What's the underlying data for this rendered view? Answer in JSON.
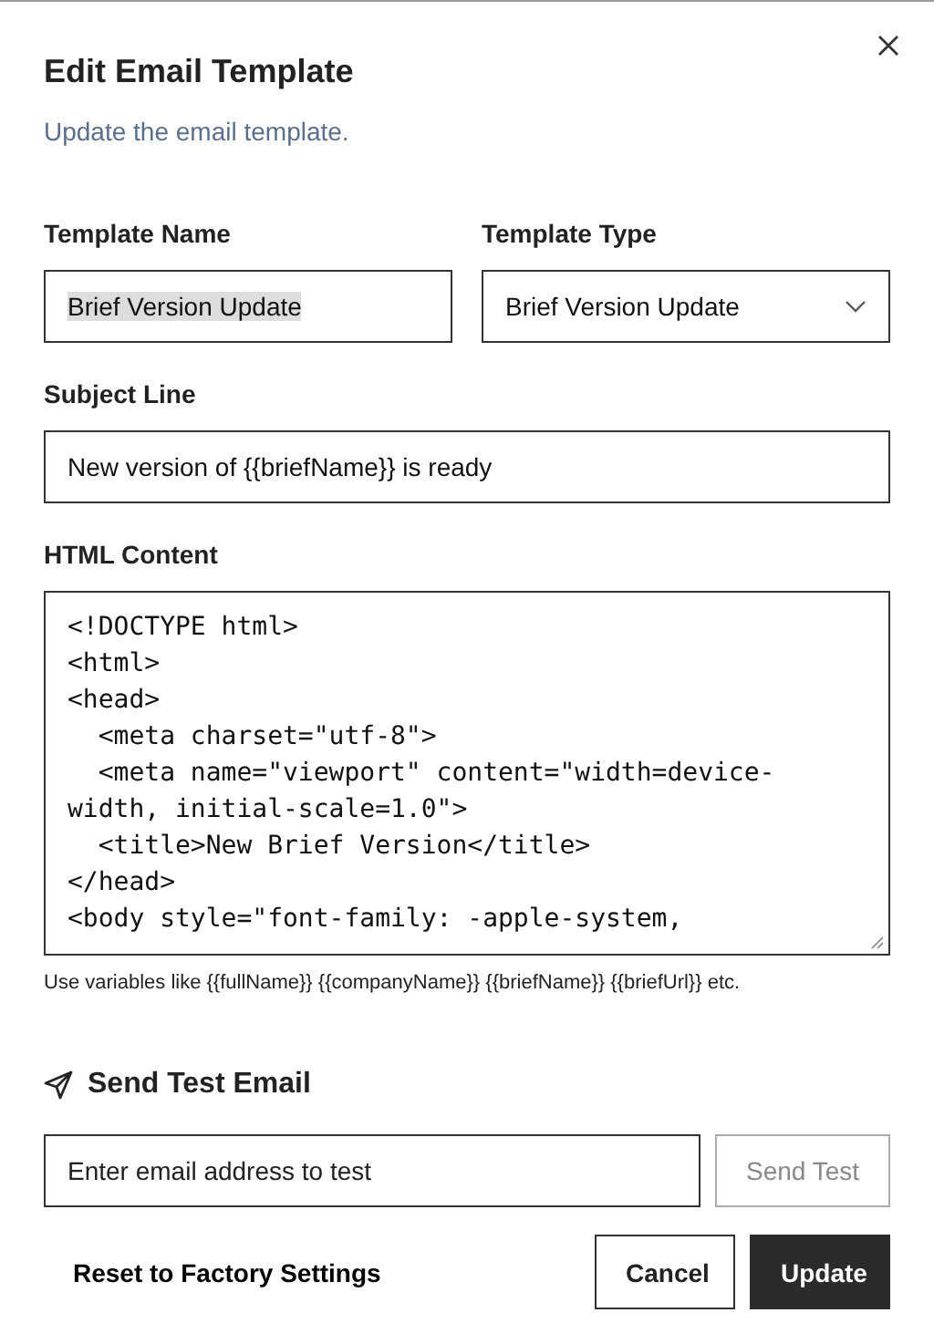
{
  "dialog": {
    "title": "Edit Email Template",
    "description": "Update the email template."
  },
  "fields": [
    {
      "kind": "text",
      "label": "Template Name",
      "value": "Brief Version Update",
      "text_selected": true
    },
    {
      "kind": "select",
      "label": "Template Type",
      "value": "Brief Version Update"
    }
  ],
  "subject": {
    "label": "Subject Line",
    "value": "New version of {{briefName}} is ready"
  },
  "html_content": {
    "label": "HTML Content",
    "value": "<!DOCTYPE html>\n<html>\n<head>\n  <meta charset=\"utf-8\">\n  <meta name=\"viewport\" content=\"width=device-width, initial-scale=1.0\">\n  <title>New Brief Version</title>\n</head>\n<body style=\"font-family: -apple-system,",
    "hint": "Use variables like {{fullName}} {{companyName}} {{briefName}} {{briefUrl}} etc."
  },
  "test_email": {
    "heading": "Send Test Email",
    "placeholder": "Enter email address to test",
    "button": {
      "label": "Send Test",
      "disabled": true
    }
  },
  "footer": {
    "reset": "Reset to Factory Settings",
    "buttons": [
      {
        "label": "Cancel",
        "kind": "secondary"
      },
      {
        "label": "Update",
        "kind": "primary"
      }
    ]
  }
}
